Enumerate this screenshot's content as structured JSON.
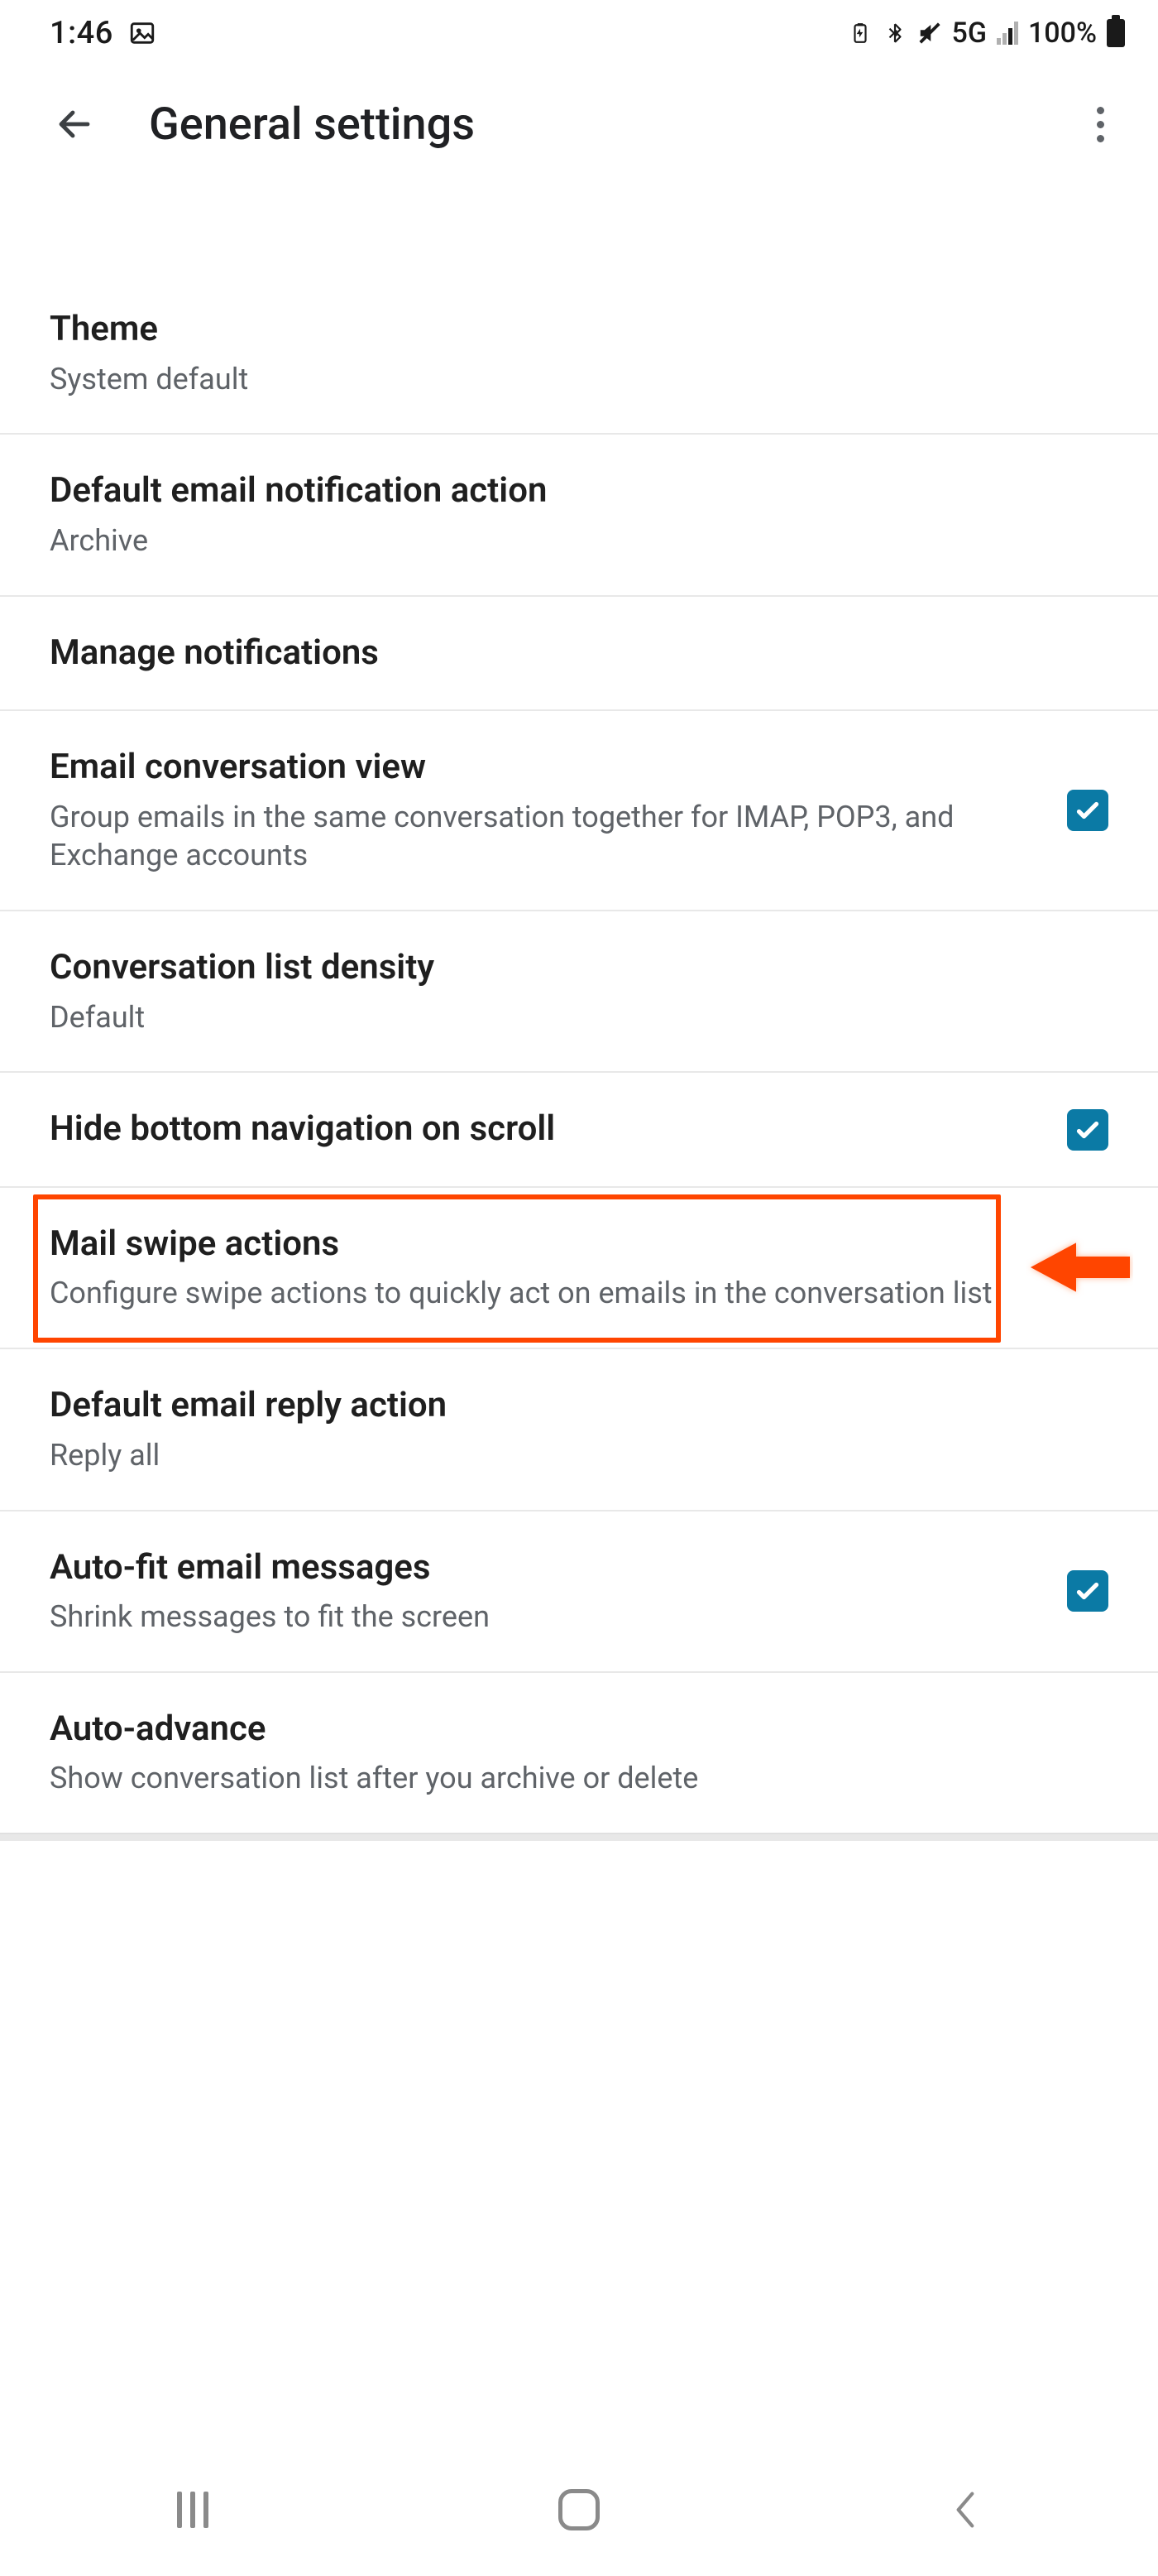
{
  "status": {
    "time": "1:46",
    "network_label": "5G",
    "battery_percent": "100%"
  },
  "appbar": {
    "title": "General settings"
  },
  "items": {
    "theme": {
      "title": "Theme",
      "sub": "System default"
    },
    "notif_action": {
      "title": "Default email notification action",
      "sub": "Archive"
    },
    "manage_notif": {
      "title": "Manage notifications"
    },
    "conv_view": {
      "title": "Email conversation view",
      "sub": "Group emails in the same conversation together for IMAP, POP3, and Exchange accounts"
    },
    "density": {
      "title": "Conversation list density",
      "sub": "Default"
    },
    "hide_nav": {
      "title": "Hide bottom navigation on scroll"
    },
    "swipe": {
      "title": "Mail swipe actions",
      "sub": "Configure swipe actions to quickly act on emails in the conversation list"
    },
    "reply_action": {
      "title": "Default email reply action",
      "sub": "Reply all"
    },
    "autofit": {
      "title": "Auto-fit email messages",
      "sub": "Shrink messages to fit the screen"
    },
    "autoadvance": {
      "title": "Auto-advance",
      "sub": "Show conversation list after you archive or delete"
    }
  },
  "checks": {
    "conv_view": true,
    "hide_nav": true,
    "autofit": true
  },
  "colors": {
    "highlight": "#ff4500",
    "check_bg": "#0b7aa5"
  }
}
